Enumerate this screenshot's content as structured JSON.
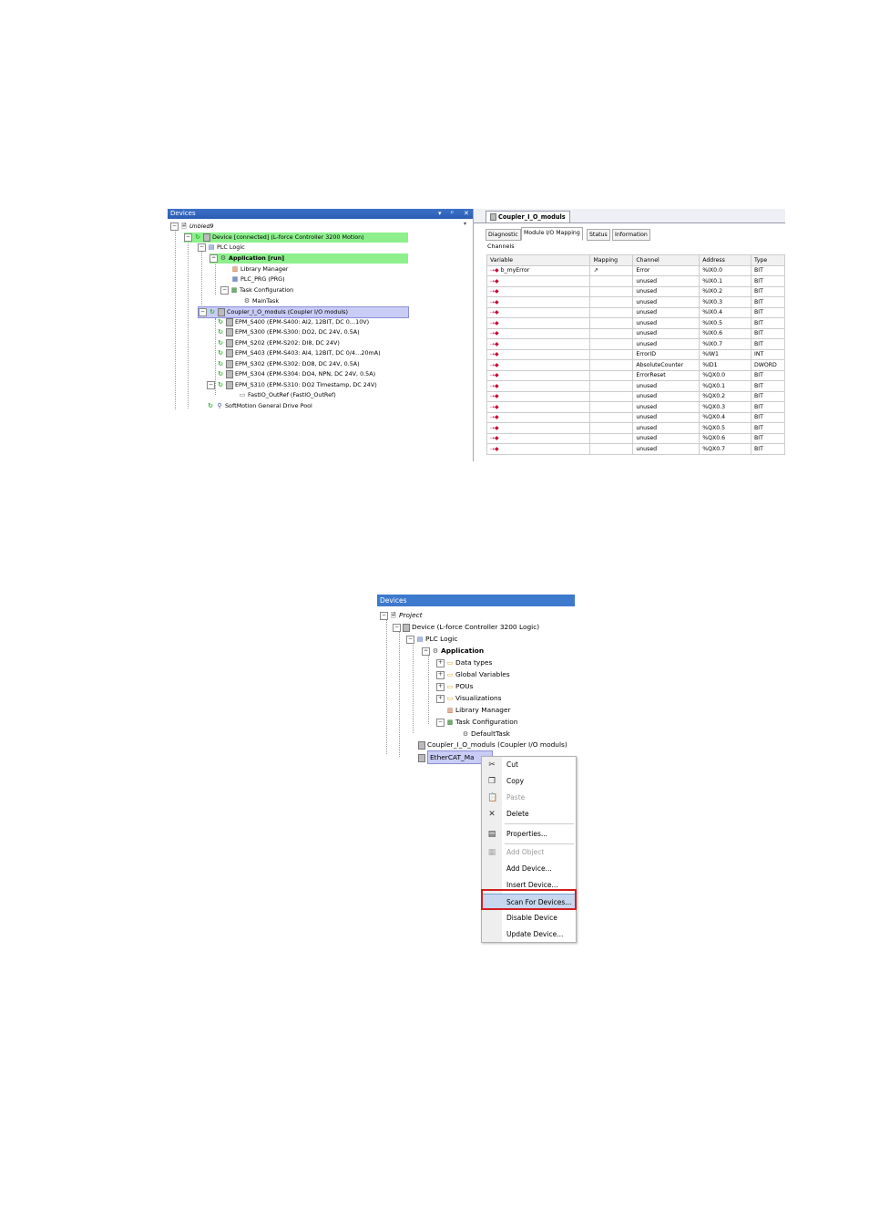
{
  "shot1": {
    "devices_panel": {
      "title": "Devices",
      "buttons": [
        "▾",
        "ᵖ",
        "✕"
      ],
      "tree": [
        {
          "label": "Unbled9",
          "style": "italic"
        },
        {
          "label": "Device [connected] (L-force Controller 3200 Motion)"
        },
        {
          "label": "PLC Logic"
        },
        {
          "label": "Application [run]"
        },
        {
          "label": "Library Manager"
        },
        {
          "label": "PLC_PRG (PRG)"
        },
        {
          "label": "Task Configuration"
        },
        {
          "label": "MainTask"
        },
        {
          "label": "Coupler_I_O_moduls (Coupler I/O moduls)"
        },
        {
          "label": "EPM_S400 (EPM-S400: AI2, 12BIT, DC 0…10V)"
        },
        {
          "label": "EPM_S300 (EPM-S300: DO2, DC 24V, 0.5A)"
        },
        {
          "label": "EPM_S202 (EPM-S202: DI8, DC 24V)"
        },
        {
          "label": "EPM_S403 (EPM-S403: AI4, 12BIT, DC 0/4…20mA)"
        },
        {
          "label": "EPM_S302 (EPM-S302: DO8, DC 24V, 0.5A)"
        },
        {
          "label": "EPM_S304 (EPM-S304: DO4, NPN, DC 24V, 0.5A)"
        },
        {
          "label": "EPM_S310 (EPM-S310: DO2 Timestamp, DC 24V)"
        },
        {
          "label": "FastIO_OutRef (FastIO_OutRef)"
        },
        {
          "label": "SoftMotion General Drive Pool"
        }
      ]
    },
    "editor": {
      "doc_tab": "Coupler_I_O_moduls",
      "tabs": [
        "Diagnostic",
        "Module I/O Mapping",
        "Status",
        "Information"
      ],
      "section": "Channels",
      "columns": [
        "Variable",
        "Mapping",
        "Channel",
        "Address",
        "Type"
      ],
      "rows": [
        {
          "variable": "b_myError",
          "mapping": "↗",
          "channel": "Error",
          "address": "%IX0.0",
          "type": "BIT"
        },
        {
          "variable": "",
          "mapping": "",
          "channel": "unused",
          "address": "%IX0.1",
          "type": "BIT"
        },
        {
          "variable": "",
          "mapping": "",
          "channel": "unused",
          "address": "%IX0.2",
          "type": "BIT"
        },
        {
          "variable": "",
          "mapping": "",
          "channel": "unused",
          "address": "%IX0.3",
          "type": "BIT"
        },
        {
          "variable": "",
          "mapping": "",
          "channel": "unused",
          "address": "%IX0.4",
          "type": "BIT"
        },
        {
          "variable": "",
          "mapping": "",
          "channel": "unused",
          "address": "%IX0.5",
          "type": "BIT"
        },
        {
          "variable": "",
          "mapping": "",
          "channel": "unused",
          "address": "%IX0.6",
          "type": "BIT"
        },
        {
          "variable": "",
          "mapping": "",
          "channel": "unused",
          "address": "%IX0.7",
          "type": "BIT"
        },
        {
          "variable": "",
          "mapping": "",
          "channel": "ErrorID",
          "address": "%IW1",
          "type": "INT"
        },
        {
          "variable": "",
          "mapping": "",
          "channel": "AbsoluteCounter",
          "address": "%ID1",
          "type": "DWORD"
        },
        {
          "variable": "",
          "mapping": "",
          "channel": "ErrorReset",
          "address": "%QX0.0",
          "type": "BIT"
        },
        {
          "variable": "",
          "mapping": "",
          "channel": "unused",
          "address": "%QX0.1",
          "type": "BIT"
        },
        {
          "variable": "",
          "mapping": "",
          "channel": "unused",
          "address": "%QX0.2",
          "type": "BIT"
        },
        {
          "variable": "",
          "mapping": "",
          "channel": "unused",
          "address": "%QX0.3",
          "type": "BIT"
        },
        {
          "variable": "",
          "mapping": "",
          "channel": "unused",
          "address": "%QX0.4",
          "type": "BIT"
        },
        {
          "variable": "",
          "mapping": "",
          "channel": "unused",
          "address": "%QX0.5",
          "type": "BIT"
        },
        {
          "variable": "",
          "mapping": "",
          "channel": "unused",
          "address": "%QX0.6",
          "type": "BIT"
        },
        {
          "variable": "",
          "mapping": "",
          "channel": "unused",
          "address": "%QX0.7",
          "type": "BIT"
        }
      ]
    }
  },
  "shot2": {
    "devices_panel": {
      "title": "Devices",
      "tree": [
        {
          "label": "Project",
          "style": "italic"
        },
        {
          "label": "Device (L-force Controller 3200 Logic)"
        },
        {
          "label": "PLC Logic"
        },
        {
          "label": "Application",
          "style": "bold"
        },
        {
          "label": "Data types"
        },
        {
          "label": "Global Variables"
        },
        {
          "label": "POUs"
        },
        {
          "label": "Visualizations"
        },
        {
          "label": "Library Manager"
        },
        {
          "label": "Task Configuration"
        },
        {
          "label": "DefaultTask"
        },
        {
          "label": "Coupler_I_O_moduls (Coupler I/O moduls)"
        },
        {
          "label": "EtherCAT_Ma"
        }
      ]
    },
    "context_menu": {
      "items": [
        {
          "label": "Cut",
          "enabled": true
        },
        {
          "label": "Copy",
          "enabled": true
        },
        {
          "label": "Paste",
          "enabled": false
        },
        {
          "label": "Delete",
          "enabled": true
        },
        {
          "label": "Properties...",
          "enabled": true
        },
        {
          "label": "Add Object",
          "enabled": false
        },
        {
          "label": "Add Device...",
          "enabled": true
        },
        {
          "label": "Insert Device...",
          "enabled": true
        },
        {
          "label": "Scan For Devices...",
          "enabled": true,
          "highlighted": true
        },
        {
          "label": "Disable Device",
          "enabled": true
        },
        {
          "label": "Update Device...",
          "enabled": true
        }
      ]
    }
  },
  "colors": {
    "panel_title": "#3d72c9",
    "running_highlight": "#8df08d",
    "selection": "#c9ccf5",
    "annotation_box": "#d21f1f"
  }
}
